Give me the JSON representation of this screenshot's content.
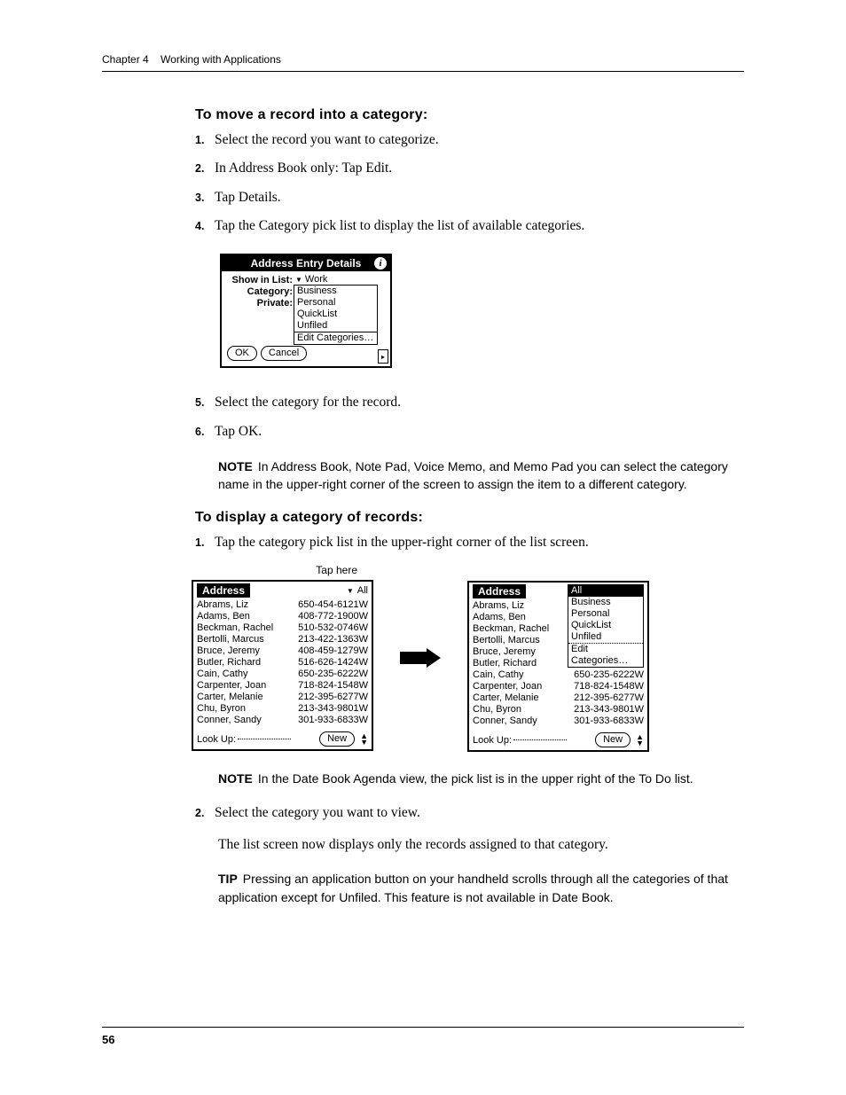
{
  "header": {
    "chapter": "Chapter 4",
    "title": "Working with Applications"
  },
  "page_number": "56",
  "section1": {
    "heading": "To move a record into a category:",
    "steps_a": [
      "Select the record you want to categorize.",
      "In Address Book only: Tap Edit.",
      "Tap Details.",
      "Tap the Category pick list to display the list of available categories."
    ],
    "steps_b": [
      "Select the category for the record.",
      "Tap OK."
    ],
    "note_lead": "NOTE",
    "note": "In Address Book, Note Pad, Voice Memo, and Memo Pad you can select the category name in the upper-right corner of the screen to assign the item to a different category."
  },
  "dialog": {
    "title": "Address Entry Details",
    "show_label": "Show in List:",
    "show_value": "Work",
    "category_label": "Category:",
    "private_label": "Private:",
    "options": [
      "Business",
      "Personal",
      "QuickList",
      "Unfiled",
      "Edit Categories…"
    ],
    "ok": "OK",
    "cancel": "Cancel"
  },
  "section2": {
    "heading": "To display a category of records:",
    "step1": "Tap the category pick list in the upper-right corner of the list screen.",
    "tap_here": "Tap here",
    "note_lead": "NOTE",
    "note": "In the Date Book Agenda view, the pick list is in the upper right of the To Do list.",
    "step2": "Select the category you want to view.",
    "after": "The list screen now displays only the records assigned to that category.",
    "tip_lead": "TIP",
    "tip": "Pressing an application button on your handheld scrolls through all the categories of that application except for Unfiled. This feature is not available in Date Book."
  },
  "address": {
    "tab": "Address",
    "category_all": "All",
    "lookup": "Look Up:",
    "new": "New",
    "menu": [
      "All",
      "Business",
      "Personal",
      "QuickList",
      "Unfiled",
      "Edit Categories…"
    ],
    "rows": [
      {
        "name": "Abrams, Liz",
        "phone": "650-454-6121W"
      },
      {
        "name": "Adams, Ben",
        "phone": "408-772-1900W"
      },
      {
        "name": "Beckman, Rachel",
        "phone": "510-532-0746W"
      },
      {
        "name": "Bertolli, Marcus",
        "phone": "213-422-1363W"
      },
      {
        "name": "Bruce, Jeremy",
        "phone": "408-459-1279W"
      },
      {
        "name": "Butler, Richard",
        "phone": "516-626-1424W"
      },
      {
        "name": "Cain, Cathy",
        "phone": "650-235-6222W"
      },
      {
        "name": "Carpenter, Joan",
        "phone": "718-824-1548W"
      },
      {
        "name": "Carter, Melanie",
        "phone": "212-395-6277W"
      },
      {
        "name": "Chu, Byron",
        "phone": "213-343-9801W"
      },
      {
        "name": "Conner, Sandy",
        "phone": "301-933-6833W"
      }
    ]
  }
}
